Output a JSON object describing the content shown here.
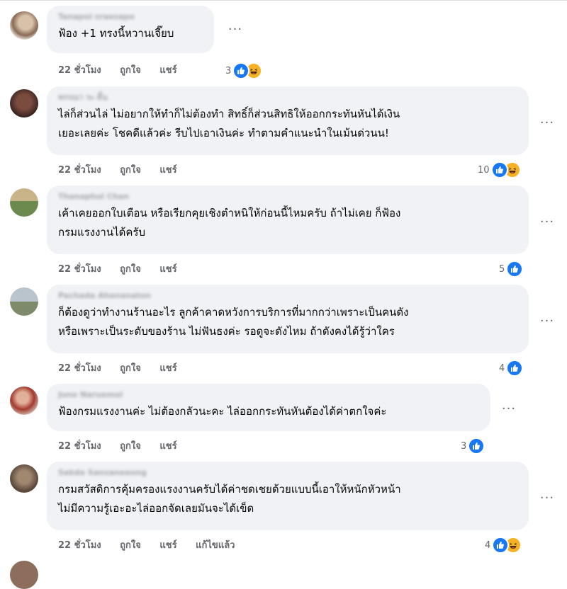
{
  "comments": [
    {
      "author": "Tanapol sraesapo",
      "lines": [
        "ฟ้อง +1 ทรงนี้หวานเจี๊ยบ"
      ],
      "time": "22 ชั่วโมง",
      "like": "ถูกใจ",
      "reply": "แชร์",
      "edited": "",
      "reaction_count": "3",
      "reactions": [
        "like-icon",
        "haha-icon"
      ]
    },
    {
      "author": "พรรณา ระ ดิ้น",
      "lines": [
        "ไล่ก็ส่วนไล่ ไม่อยากให้ทำก็ไม่ต้องทำ สิทธิ์ก็ส่วนสิทธิให้ออกกระทันหันได้เงิน",
        "เยอะเลยค่ะ โชคดีแล้วค่ะ รีบไปเอาเงินค่ะ ทำตามคำแนะนำในเม้นด่วนน!"
      ],
      "time": "22 ชั่วโมง",
      "like": "ถูกใจ",
      "reply": "แชร์",
      "edited": "",
      "reaction_count": "10",
      "reactions": [
        "like-icon",
        "haha-icon"
      ]
    },
    {
      "author": "Thanaphol Chan",
      "lines": [
        "เค้าเคยออกใบเตือน หรือเรียกคุยเชิงตำหนิให้ก่อนนี้ไหมครับ ถ้าไม่เคย ก็ฟ้อง",
        "กรมแรงงานได้ครับ"
      ],
      "time": "22 ชั่วโมง",
      "like": "ถูกใจ",
      "reply": "แชร์",
      "edited": "",
      "reaction_count": "5",
      "reactions": [
        "like-icon"
      ]
    },
    {
      "author": "Pachada Ahananaton",
      "lines": [
        "ก็ต้องดูว่าทำงานร้านอะไร ลูกค้าคาดหวังการบริการที่มากกว่าเพราะเป็นคนดัง",
        "หรือเพราะเป็นระดับของร้าน ไม่ฟันธงค่ะ รอดูจะดังไหม ถ้าดังคงได้รู้ว่าใคร"
      ],
      "time": "22 ชั่วโมง",
      "like": "ถูกใจ",
      "reply": "แชร์",
      "edited": "",
      "reaction_count": "4",
      "reactions": [
        "like-icon"
      ]
    },
    {
      "author": "June Naruemol",
      "lines": [
        "ฟ้องกรมแรงงานค่ะ ไม่ต้องกลัวนะคะ ไล่ออกกระทันหันต้องได้ค่าตกใจค่ะ"
      ],
      "time": "22 ชั่วโมง",
      "like": "ถูกใจ",
      "reply": "แชร์",
      "edited": "",
      "reaction_count": "3",
      "reactions": [
        "like-icon"
      ]
    },
    {
      "author": "Sakda Sansaneeong",
      "lines": [
        "กรมสวัสดิการคุ้มครองแรงงานครับได้ค่าชดเชยด้วยแบบนี้เอาให้หนักหัวหน้า",
        "ไม่มีความรู้เอะอะไล่ออกจัดเลยมันจะได้เข็ด"
      ],
      "time": "22 ชั่วโมง",
      "like": "ถูกใจ",
      "reply": "แชร์",
      "edited": "แก้ไขแล้ว",
      "reaction_count": "4",
      "reactions": [
        "like-icon",
        "haha-icon"
      ]
    }
  ],
  "colors": {
    "bubble": "#f0f2f5",
    "meta": "#65676b",
    "like": "#1877f2",
    "haha": "#f7b125"
  }
}
